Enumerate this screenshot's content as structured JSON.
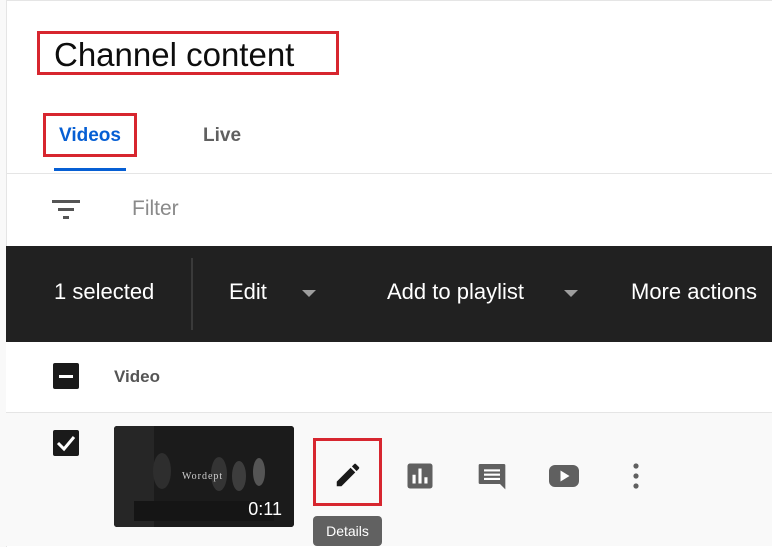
{
  "page": {
    "title": "Channel content"
  },
  "tabs": [
    {
      "label": "Videos",
      "active": true
    },
    {
      "label": "Live",
      "active": false
    }
  ],
  "filter": {
    "placeholder": "Filter",
    "icon": "filter-icon"
  },
  "action_bar": {
    "selected_text": "1 selected",
    "edit_label": "Edit",
    "add_to_playlist_label": "Add to playlist",
    "more_actions_label": "More actions"
  },
  "table": {
    "header": {
      "video_col": "Video",
      "checkbox_state": "indeterminate"
    },
    "rows": [
      {
        "checked": true,
        "thumbnail_text": "Wordept",
        "duration": "0:11",
        "actions": [
          "pencil-icon",
          "analytics-icon",
          "comments-icon",
          "youtube-icon",
          "more-vert-icon"
        ]
      }
    ]
  },
  "tooltip": {
    "text": "Details"
  },
  "colors": {
    "accent": "#065fd4",
    "highlight": "#d7262f",
    "action_bar": "#212121"
  }
}
